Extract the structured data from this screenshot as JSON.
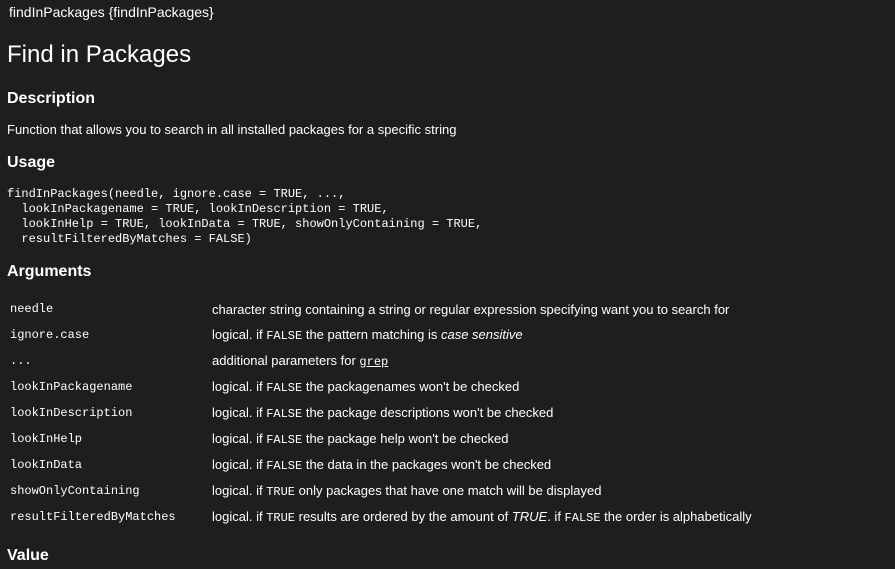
{
  "header": {
    "title_line": "findInPackages {findInPackages}"
  },
  "page": {
    "title": "Find in Packages"
  },
  "sections": {
    "description": {
      "heading": "Description",
      "text": "Function that allows you to search in all installed packages for a specific string"
    },
    "usage": {
      "heading": "Usage",
      "code": "findInPackages(needle, ignore.case = TRUE, ...,\n  lookInPackagename = TRUE, lookInDescription = TRUE,\n  lookInHelp = TRUE, lookInData = TRUE, showOnlyContaining = TRUE,\n  resultFilteredByMatches = FALSE)"
    },
    "arguments": {
      "heading": "Arguments",
      "rows": [
        {
          "name": "needle",
          "desc": "character string containing a string or regular expression specifying want you to search for"
        },
        {
          "name": "ignore.case",
          "desc_pre": "logical. if ",
          "desc_code": "FALSE",
          "desc_mid": " the pattern matching is ",
          "desc_em": "case sensitive"
        },
        {
          "name": "...",
          "desc_pre": "additional parameters for ",
          "desc_link": "grep"
        },
        {
          "name": "lookInPackagename",
          "desc_pre": "logical. if ",
          "desc_code": "FALSE",
          "desc_post": " the packagenames won't be checked"
        },
        {
          "name": "lookInDescription",
          "desc_pre": "logical. if ",
          "desc_code": "FALSE",
          "desc_post": " the package descriptions won't be checked"
        },
        {
          "name": "lookInHelp",
          "desc_pre": "logical. if ",
          "desc_code": "FALSE",
          "desc_post": " the package help won't be checked"
        },
        {
          "name": "lookInData",
          "desc_pre": "logical. if ",
          "desc_code": "FALSE",
          "desc_post": " the data in the packages won't be checked"
        },
        {
          "name": "showOnlyContaining",
          "desc_pre": "logical. if ",
          "desc_code": "TRUE",
          "desc_post": " only packages that have one match will be displayed"
        },
        {
          "name": "resultFilteredByMatches",
          "desc_pre": "logical. if ",
          "desc_code": "TRUE",
          "desc_mid": " results are ordered by the amount of ",
          "desc_em": "TRUE",
          "desc_mid2": ". if ",
          "desc_code2": "FALSE",
          "desc_post": " the order is alphabetically"
        }
      ]
    },
    "value": {
      "heading": "Value"
    }
  },
  "colors": {
    "background": "#1e1e1e",
    "text": "#ffffff"
  }
}
